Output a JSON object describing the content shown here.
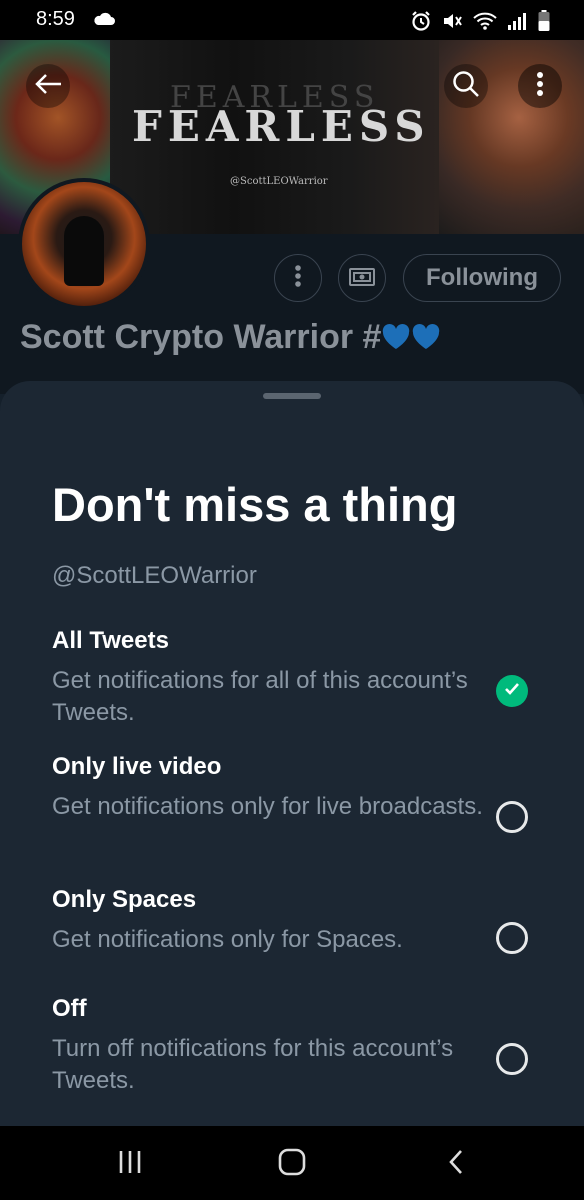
{
  "status_bar": {
    "time": "8:59",
    "icons": [
      "cloud-icon",
      "alarm-icon",
      "mute-icon",
      "wifi-icon",
      "signal-icon",
      "battery-icon"
    ]
  },
  "banner": {
    "title": "FEARLESS",
    "handle": "@ScottLEOWarrior",
    "icons": [
      "back-arrow-icon",
      "search-icon",
      "more-vertical-icon"
    ]
  },
  "profile": {
    "display_name": "Scott Crypto Warrior #",
    "following_label": "Following",
    "action_icons": [
      "more-horizontal-icon",
      "tip-jar-icon"
    ]
  },
  "sheet": {
    "title": "Don't miss a thing",
    "handle": "@ScottLEOWarrior",
    "options": [
      {
        "label": "All Tweets",
        "description": "Get notifications for all of this account’s Tweets.",
        "selected": true
      },
      {
        "label": "Only live video",
        "description": "Get notifications only for live broadcasts.",
        "selected": false
      },
      {
        "label": "Only Spaces",
        "description": "Get notifications only for Spaces.",
        "selected": false
      },
      {
        "label": "Off",
        "description": "Turn off notifications for this account’s Tweets.",
        "selected": false
      }
    ]
  },
  "nav_bar": {
    "icons": [
      "recent-apps-icon",
      "home-icon",
      "back-icon"
    ]
  },
  "colors": {
    "accent_selected": "#00ba7c",
    "sheet_bg": "#1c2733",
    "muted_text": "#8b98a5",
    "heart_blue": "#1d6fb8"
  }
}
